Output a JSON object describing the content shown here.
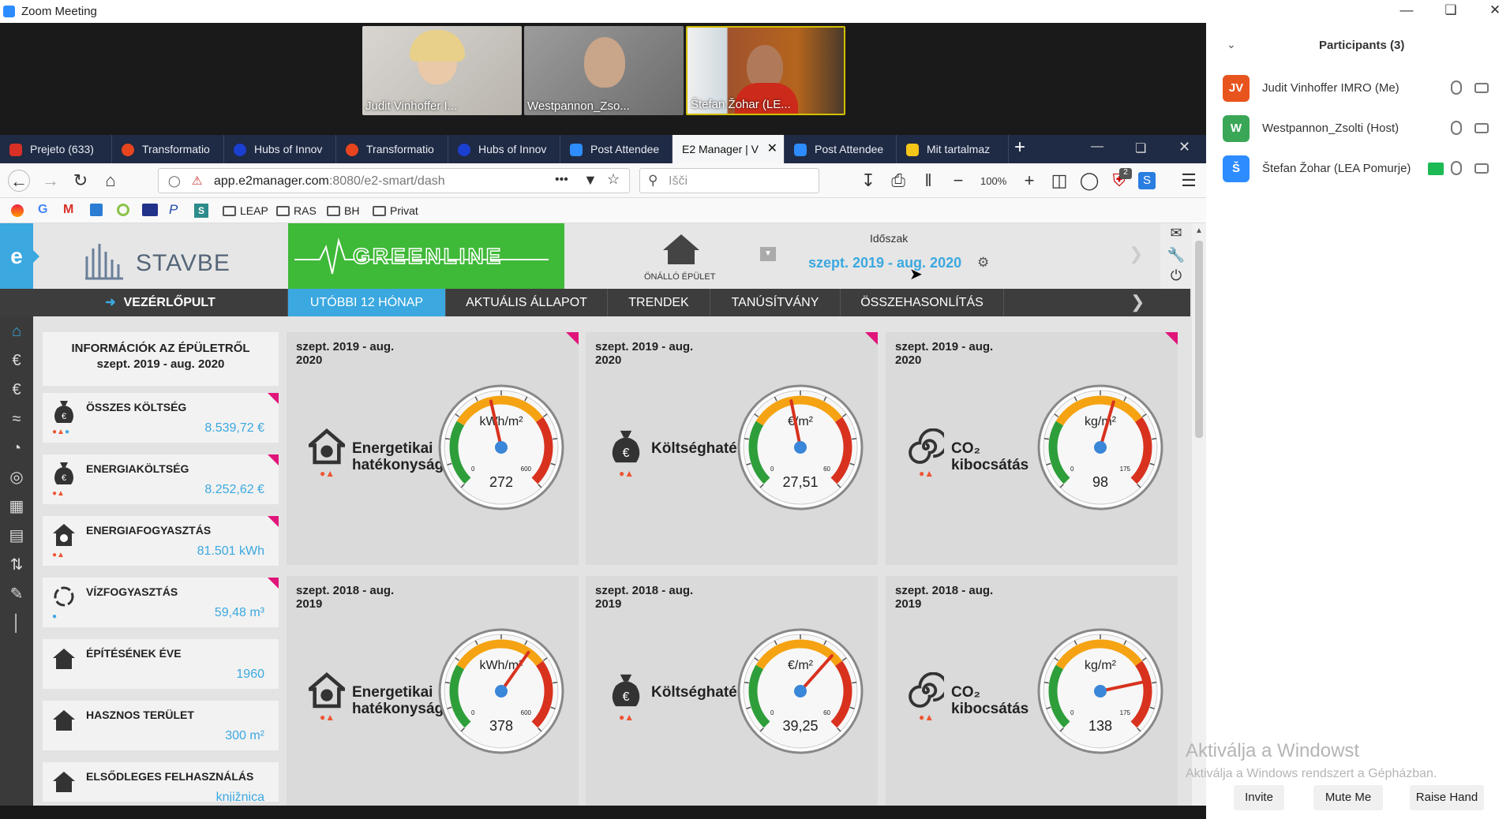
{
  "zoom": {
    "window_title": "Zoom Meeting",
    "participants_header": "Participants (3)",
    "participants": [
      {
        "initials": "JV",
        "name": "Judit Vinhoffer IMRO (Me)",
        "color": "#e8541e"
      },
      {
        "initials": "W",
        "name": "Westpannon_Zsolti (Host)",
        "color": "#3aa757"
      },
      {
        "initials": "Š",
        "name": "Štefan Žohar (LEA Pomurje)",
        "color": "#2d8cff"
      }
    ],
    "video_tiles": [
      {
        "label": "Judit Vinhoffer I..."
      },
      {
        "label": "Westpannon_Zso..."
      },
      {
        "label": "Štefan Žohar (LE..."
      }
    ],
    "buttons": {
      "invite": "Invite",
      "mute": "Mute Me",
      "raise_hand": "Raise Hand"
    },
    "watermark_line1": "Aktiválja a Windowst",
    "watermark_line2": "Aktiválja a Windows rendszert a Gépházban."
  },
  "browser": {
    "tabs": [
      {
        "label": "Prejeto (633)",
        "color": "#d93025"
      },
      {
        "label": "Transformatio",
        "color": "#e8451e"
      },
      {
        "label": "Hubs of Innov",
        "color": "#1a3fd1"
      },
      {
        "label": "Transformatio",
        "color": "#e8451e"
      },
      {
        "label": "Hubs of Innov",
        "color": "#1a3fd1"
      },
      {
        "label": "Post Attendee",
        "color": "#2d8cff"
      },
      {
        "label": "E2 Manager | V",
        "color": "#ffffff"
      },
      {
        "label": "Post Attendee",
        "color": "#2d8cff"
      },
      {
        "label": "Mit tartalmaz",
        "color": "#f5c518"
      }
    ],
    "new_tab": "+",
    "url_host": "app.e2manager.com",
    "url_rest": ":8080/e2-smart/dash",
    "search_placeholder": "Išči",
    "zoom_level": "100%",
    "bookmarks": [
      "LEAP",
      "RAS",
      "BH",
      "Privat"
    ],
    "badge_count": "2"
  },
  "app": {
    "brand": "STAVBE",
    "greenline": "GREENLINE",
    "building_type": "ÖNÁLLÓ ÉPÜLET",
    "period_label": "Időszak",
    "period_value": "szept. 2019 - aug. 2020",
    "menu": {
      "dashboard": "VEZÉRLŐPULT",
      "tabs": [
        "UTÓBBI 12 HÓNAP",
        "AKTUÁLIS ÁLLAPOT",
        "TRENDEK",
        "TANÚSÍTVÁNY",
        "ÖSSZEHASONLÍTÁS"
      ]
    },
    "info_header_line1": "INFORMÁCIÓK AZ ÉPÜLETRŐL",
    "info_header_line2": "szept. 2019 - aug. 2020",
    "info_cards": [
      {
        "label": "ÖSSZES KÖLTSÉG",
        "value": "8.539,72 €"
      },
      {
        "label": "ENERGIAKÖLTSÉG",
        "value": "8.252,62 €"
      },
      {
        "label": "ENERGIAFOGYASZTÁS",
        "value": "81.501 kWh"
      },
      {
        "label": "VÍZFOGYASZTÁS",
        "value": "59,48 m³"
      },
      {
        "label": "ÉPÍTÉSÉNEK ÉVE",
        "value": "1960"
      },
      {
        "label": "HASZNOS TERÜLET",
        "value": "300 m²"
      },
      {
        "label": "ELSŐDLEGES FELHASZNÁLÁS",
        "value": "knjižnica"
      }
    ],
    "gauges": [
      {
        "period": "szept. 2019 - aug. 2020",
        "title_line1": "Energetikai",
        "title_line2": "hatékonyság",
        "unit": "kWh/m²",
        "min": "0",
        "max": "600",
        "value": "272",
        "v": 272,
        "vmax": 600
      },
      {
        "period": "szept. 2019 - aug. 2020",
        "title_line1": "Költséghaté",
        "title_line2": "",
        "unit": "€/m²",
        "min": "0",
        "max": "60",
        "value": "27,51",
        "v": 27.51,
        "vmax": 60
      },
      {
        "period": "szept. 2019 - aug. 2020",
        "title_line1": "CO₂",
        "title_line2": "kibocsátás",
        "unit": "kg/m²",
        "min": "0",
        "max": "175",
        "value": "98",
        "v": 98,
        "vmax": 175
      },
      {
        "period": "szept. 2018 - aug. 2019",
        "title_line1": "Energetikai",
        "title_line2": "hatékonyság",
        "unit": "kWh/m²",
        "min": "0",
        "max": "600",
        "value": "378",
        "v": 378,
        "vmax": 600
      },
      {
        "period": "szept. 2018 - aug. 2019",
        "title_line1": "Költséghaté",
        "title_line2": "",
        "unit": "€/m²",
        "min": "0",
        "max": "60",
        "value": "39,25",
        "v": 39.25,
        "vmax": 60
      },
      {
        "period": "szept. 2018 - aug. 2019",
        "title_line1": "CO₂",
        "title_line2": "kibocsátás",
        "unit": "kg/m²",
        "min": "0",
        "max": "175",
        "value": "138",
        "v": 138,
        "vmax": 175
      }
    ],
    "colors": {
      "accent": "#3ba8e0",
      "green": "#3fb938",
      "magenta": "#e0157a"
    }
  }
}
